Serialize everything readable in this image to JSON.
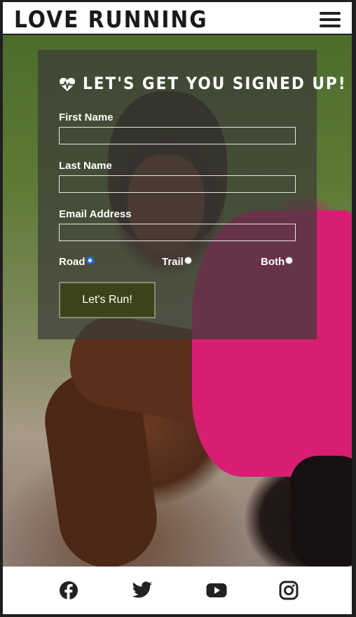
{
  "header": {
    "logo": "LOVE RUNNING"
  },
  "form": {
    "title": "LET'S GET YOU SIGNED UP!",
    "first_name_label": "First Name",
    "first_name_value": "",
    "last_name_label": "Last Name",
    "last_name_value": "",
    "email_label": "Email Address",
    "email_value": "",
    "options": [
      "Road",
      "Trail",
      "Both"
    ],
    "selected_option": "Road",
    "submit_label": "Let's Run!"
  },
  "footer": {
    "icons": [
      "facebook-icon",
      "twitter-icon",
      "youtube-icon",
      "instagram-icon"
    ]
  },
  "colors": {
    "button_bg": "#3b4419",
    "radio_selected": "#1a6de3",
    "shirt_pink": "#d81e72"
  }
}
